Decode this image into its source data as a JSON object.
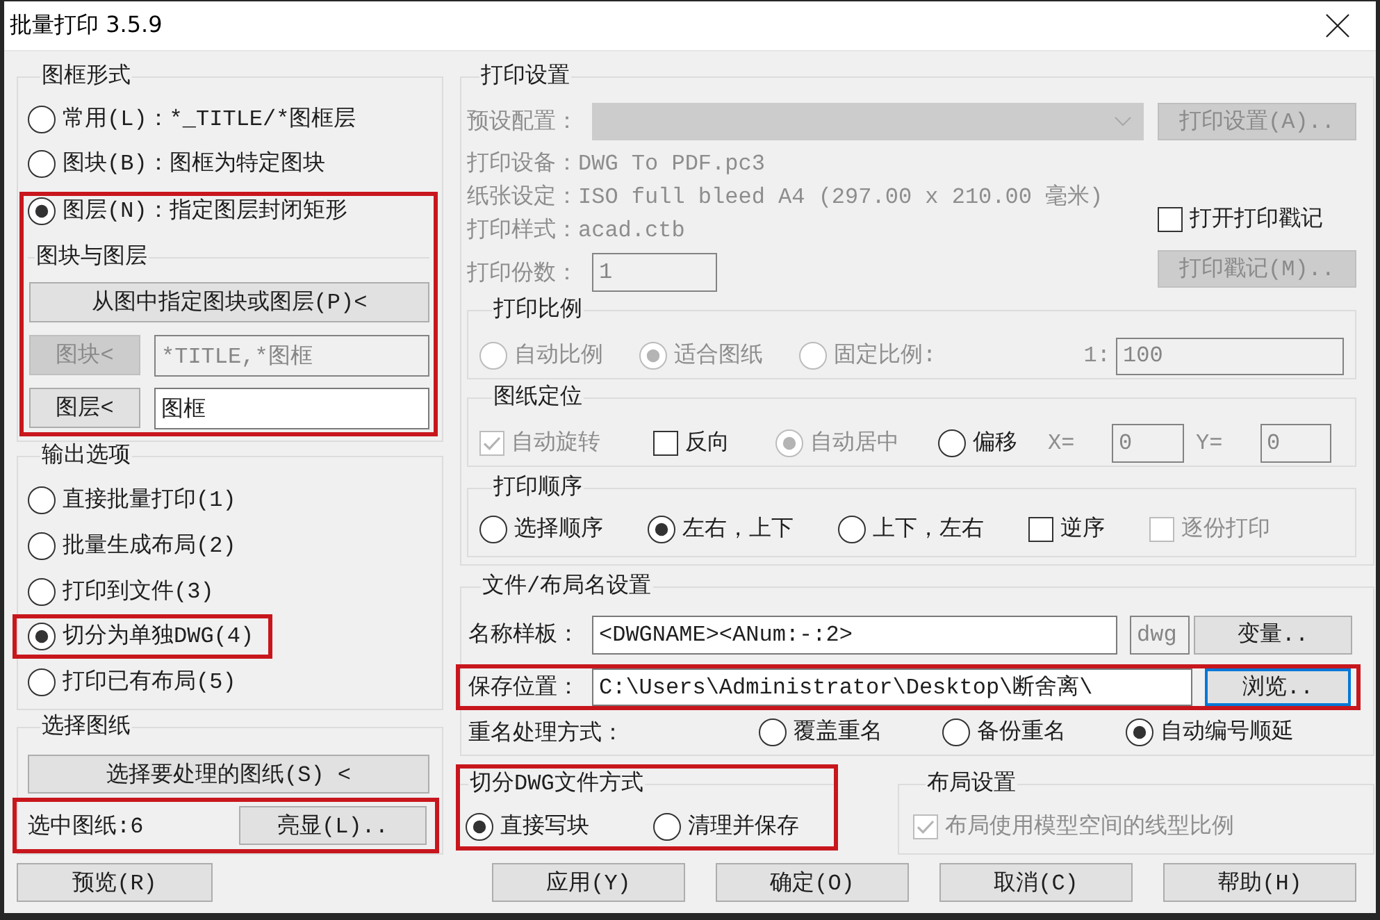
{
  "window": {
    "title": "批量打印 3.5.9"
  },
  "frame_style": {
    "title": "图框形式",
    "options": [
      {
        "label": "常用(L)：*_TITLE/*图框层",
        "selected": false
      },
      {
        "label": "图块(B)：图框为特定图块",
        "selected": false
      },
      {
        "label": "图层(N)：指定图层封闭矩形",
        "selected": true
      }
    ]
  },
  "block_layer": {
    "title": "图块与图层",
    "highlighted": true,
    "pick_button": "从图中指定图块或图层(P)<",
    "rows": [
      {
        "button": "图块<",
        "value": "*TITLE,*图框",
        "disabled": true
      },
      {
        "button": "图层<",
        "value": "图框",
        "disabled": false
      }
    ]
  },
  "output": {
    "title": "输出选项",
    "options": [
      {
        "label": "直接批量打印(1)",
        "selected": false,
        "highlighted": false
      },
      {
        "label": "批量生成布局(2)",
        "selected": false,
        "highlighted": false
      },
      {
        "label": "打印到文件(3)",
        "selected": false,
        "highlighted": false
      },
      {
        "label": "切分为单独DWG(4)",
        "selected": true,
        "highlighted": true
      },
      {
        "label": "打印已有布局(5)",
        "selected": false,
        "highlighted": false
      }
    ]
  },
  "sheets": {
    "title": "选择图纸",
    "select_button": "选择要处理的图纸(S) <",
    "count": "选中图纸:6",
    "highlight_button": "亮显(L)..",
    "highlighted": true
  },
  "print_settings": {
    "title": "打印设置",
    "preset": {
      "label": "预设配置：",
      "disabled": true
    },
    "setup_button": {
      "label": "打印设置(A)..",
      "disabled": true
    },
    "info": [
      {
        "label": "打印设备：",
        "value": "DWG To PDF.pc3"
      },
      {
        "label": "纸张设定：",
        "value": "ISO full bleed A4 (297.00 x 210.00 毫米)"
      },
      {
        "label": "打印样式：",
        "value": "acad.ctb"
      }
    ],
    "stamp_checkbox": {
      "label": "打开打印戳记",
      "checked": false
    },
    "copies": {
      "label": "打印份数：",
      "value": "1",
      "disabled": true
    },
    "stamp_button": {
      "label": "打印戳记(M)..",
      "disabled": true
    },
    "scale": {
      "title": "打印比例",
      "options": [
        {
          "label": "自动比例",
          "selected": false,
          "disabled": true
        },
        {
          "label": "适合图纸",
          "selected": true,
          "disabled": true
        },
        {
          "label": "固定比例:",
          "selected": false,
          "disabled": true
        }
      ],
      "ratio": {
        "label": "1:",
        "value": "100",
        "disabled": true
      }
    },
    "placement": {
      "title": "图纸定位",
      "controls": [
        {
          "kind": "checkbox",
          "label": "自动旋转",
          "checked": true,
          "disabled": true
        },
        {
          "kind": "checkbox",
          "label": "反向",
          "checked": false,
          "disabled": false
        },
        {
          "kind": "radio",
          "label": "自动居中",
          "selected": true,
          "disabled": true
        },
        {
          "kind": "radio",
          "label": "偏移",
          "selected": false,
          "disabled": false
        }
      ],
      "offsets": [
        {
          "label": "X=",
          "value": "0",
          "disabled": true
        },
        {
          "label": "Y=",
          "value": "0",
          "disabled": true
        }
      ]
    },
    "order": {
      "title": "打印顺序",
      "controls": [
        {
          "kind": "radio",
          "label": "选择顺序",
          "selected": false,
          "disabled": false
        },
        {
          "kind": "radio",
          "label": "左右，上下",
          "selected": true,
          "disabled": false
        },
        {
          "kind": "radio",
          "label": "上下，左右",
          "selected": false,
          "disabled": false
        },
        {
          "kind": "checkbox",
          "label": "逆序",
          "checked": false,
          "disabled": false
        },
        {
          "kind": "checkbox",
          "label": "逐份打印",
          "checked": false,
          "disabled": true
        }
      ]
    }
  },
  "naming": {
    "title": "文件/布局名设置",
    "template": {
      "label": "名称样板：",
      "value": "<DWGNAME><ANum:-:2>",
      "extension": {
        "value": "dwg",
        "disabled": true
      },
      "variables_button": "变量.."
    },
    "save": {
      "label": "保存位置：",
      "value": "C:\\Users\\Administrator\\Desktop\\断舍离\\",
      "browse_button": {
        "label": "浏览..",
        "focused": true
      },
      "highlighted": true
    },
    "rename": {
      "label": "重名处理方式：",
      "options": [
        {
          "label": "覆盖重名",
          "selected": false
        },
        {
          "label": "备份重名",
          "selected": false
        },
        {
          "label": "自动编号顺延",
          "selected": true
        }
      ]
    }
  },
  "split_mode": {
    "title": "切分DWG文件方式",
    "highlighted": true,
    "options": [
      {
        "label": "直接写块",
        "selected": true
      },
      {
        "label": "清理并保存",
        "selected": false
      }
    ]
  },
  "layout_settings": {
    "title": "布局设置",
    "checkbox": {
      "label": "布局使用模型空间的线型比例",
      "checked": true,
      "disabled": true
    }
  },
  "buttons": [
    "预览(R)",
    "应用(Y)",
    "确定(O)",
    "取消(C)",
    "帮助(H)"
  ]
}
